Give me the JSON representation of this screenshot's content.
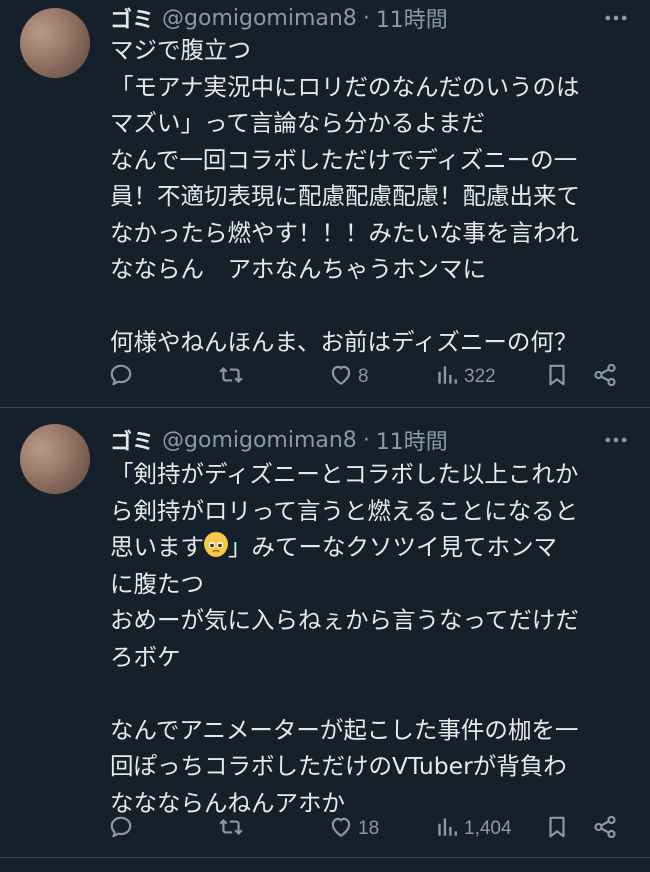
{
  "colors": {
    "background": "#15202b",
    "text": "#e7e9ea",
    "muted": "#8b98a5",
    "divider": "#38444d"
  },
  "tweets": [
    {
      "author": {
        "name": "ゴミ",
        "handle": "@gomigomiman8",
        "separator": "·",
        "time": "11時間"
      },
      "lines": [
        "マジで腹立つ",
        "「モアナ実況中にロリだのなんだのいうのは",
        "マズい」って言論なら分かるよまだ",
        "なんで一回コラボしただけでディズニーの一",
        "員！不適切表現に配慮配慮配慮！配慮出来て",
        "なかったら燃やす！！！みたいな事を言われ",
        "なならん　アホなんちゃうホンマに",
        "",
        "何様やねんほんま、お前はディズニーの何？"
      ],
      "stats": {
        "replies": "",
        "retweets": "",
        "likes": "8",
        "views": "322"
      },
      "icons": [
        "reply-icon",
        "retweet-icon",
        "heart-icon",
        "views-icon",
        "bookmark-icon",
        "share-icon",
        "more-icon"
      ]
    },
    {
      "author": {
        "name": "ゴミ",
        "handle": "@gomigomiman8",
        "separator": "·",
        "time": "11時間"
      },
      "lines": [
        "「剣持がディズニーとコラボした以上これか",
        "ら剣持がロリって言うと燃えることになると",
        "思います",
        "に腹たつ",
        "おめーが気に入らねぇから言うなってだけだ",
        "ろボケ",
        "",
        "なんでアニメーターが起こした事件の枷を一",
        "回ぽっちコラボしただけのVTuberが背負わ",
        "ななならんねんアホか"
      ],
      "line3_suffix": "」みてーなクソツイ見てホンマ",
      "stats": {
        "replies": "",
        "retweets": "",
        "likes": "18",
        "views": "1,404"
      },
      "icons": [
        "reply-icon",
        "retweet-icon",
        "heart-icon",
        "views-icon",
        "bookmark-icon",
        "share-icon",
        "more-icon"
      ]
    }
  ]
}
